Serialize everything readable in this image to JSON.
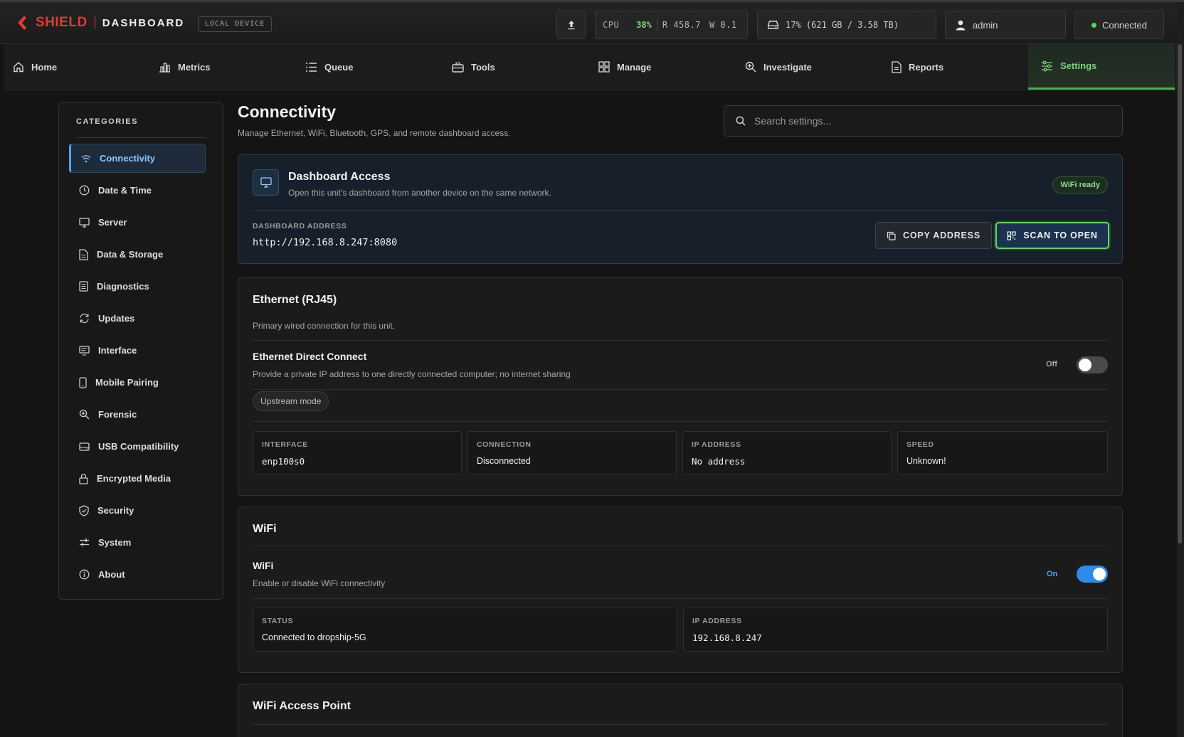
{
  "brand": {
    "name": "SHIELD",
    "section": "DASHBOARD",
    "device": "LOCAL DEVICE",
    "accent": "#e53935"
  },
  "status": {
    "cpu_label": "CPU",
    "cpu_pct": "38%",
    "read": "R 458.7",
    "write": "W 0.1",
    "disk": "17% (621 GB / 3.58 TB)",
    "user": "admin",
    "connection": "Connected"
  },
  "nav": {
    "tabs": [
      {
        "label": "Home",
        "icon": "home-icon"
      },
      {
        "label": "Metrics",
        "icon": "bar-chart-icon"
      },
      {
        "label": "Queue",
        "icon": "list-icon"
      },
      {
        "label": "Tools",
        "icon": "briefcase-icon"
      },
      {
        "label": "Manage",
        "icon": "grid-icon"
      },
      {
        "label": "Investigate",
        "icon": "zoom-in-icon"
      },
      {
        "label": "Reports",
        "icon": "document-icon"
      },
      {
        "label": "Settings",
        "icon": "sliders-icon"
      }
    ],
    "active": "Settings",
    "active_color": "#4caf50"
  },
  "sidebar": {
    "title": "CATEGORIES",
    "items": [
      {
        "label": "Connectivity",
        "icon": "wifi-icon"
      },
      {
        "label": "Date & Time",
        "icon": "clock-icon"
      },
      {
        "label": "Server",
        "icon": "monitor-icon"
      },
      {
        "label": "Data & Storage",
        "icon": "file-icon"
      },
      {
        "label": "Diagnostics",
        "icon": "list-doc-icon"
      },
      {
        "label": "Updates",
        "icon": "refresh-icon"
      },
      {
        "label": "Interface",
        "icon": "display-icon"
      },
      {
        "label": "Mobile Pairing",
        "icon": "phone-icon"
      },
      {
        "label": "Forensic",
        "icon": "zoom-in-icon"
      },
      {
        "label": "USB Compatibility",
        "icon": "drive-icon"
      },
      {
        "label": "Encrypted Media",
        "icon": "lock-icon"
      },
      {
        "label": "Security",
        "icon": "shield-icon"
      },
      {
        "label": "System",
        "icon": "sliders-icon"
      },
      {
        "label": "About",
        "icon": "info-icon"
      }
    ],
    "active": "Connectivity",
    "active_color": "#4aa3f0"
  },
  "page": {
    "title": "Connectivity",
    "subtitle": "Manage Ethernet, WiFi, Bluetooth, GPS, and remote dashboard access.",
    "search_placeholder": "Search settings..."
  },
  "access": {
    "title": "Dashboard Access",
    "desc": "Open this unit's dashboard from another device on the same network.",
    "badge": "WiFi ready",
    "address_label": "DASHBOARD ADDRESS",
    "address": "http://192.168.8.247:8080",
    "copy_label": "COPY ADDRESS",
    "scan_label": "SCAN TO OPEN"
  },
  "ethernet": {
    "title": "Ethernet (RJ45)",
    "desc": "Primary wired connection for this unit.",
    "direct_title": "Ethernet Direct Connect",
    "direct_desc": "Provide a private IP address to one directly connected computer; no internet sharing",
    "toggle_state": "Off",
    "mode_pill": "Upstream mode",
    "stats": [
      {
        "label": "INTERFACE",
        "value": "enp100s0",
        "mono": true
      },
      {
        "label": "CONNECTION",
        "value": "Disconnected",
        "mono": false
      },
      {
        "label": "IP ADDRESS",
        "value": "No address",
        "mono": true
      },
      {
        "label": "SPEED",
        "value": "Unknown!",
        "mono": false
      }
    ]
  },
  "wifi": {
    "title": "WiFi",
    "row_title": "WiFi",
    "row_desc": "Enable or disable WiFi connectivity",
    "toggle_state": "On",
    "stats": [
      {
        "label": "STATUS",
        "value": "Connected to dropship-5G",
        "mono": false
      },
      {
        "label": "IP ADDRESS",
        "value": "192.168.8.247",
        "mono": true
      }
    ]
  },
  "access_point": {
    "title": "WiFi Access Point"
  }
}
